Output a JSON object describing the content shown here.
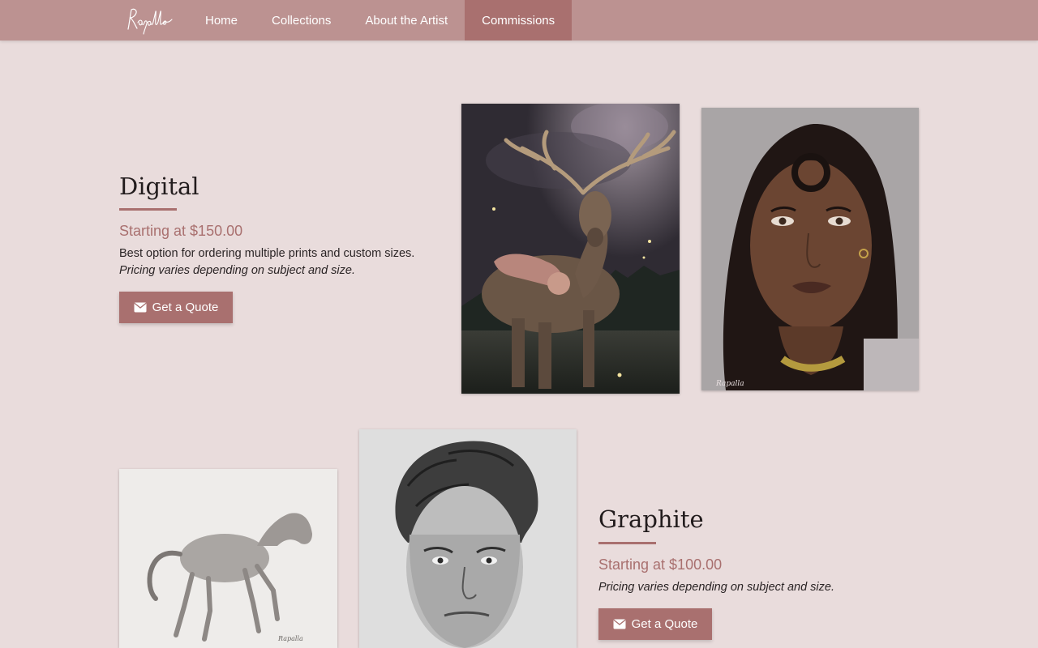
{
  "nav": {
    "logo_text": "Rapalla",
    "items": [
      {
        "label": "Home"
      },
      {
        "label": "Collections"
      },
      {
        "label": "About the Artist"
      },
      {
        "label": "Commissions"
      }
    ]
  },
  "digital": {
    "title": "Digital",
    "price": "Starting at $150.00",
    "description": "Best option for ordering multiple prints and custom sizes.",
    "note": "Pricing varies depending on subject and size.",
    "button_label": "Get a Quote",
    "button_icon": "envelope-icon",
    "artworks": [
      {
        "subject": "deer-with-fairy-painting"
      },
      {
        "subject": "woman-portrait-painting",
        "signature": "Rapalla"
      }
    ]
  },
  "graphite": {
    "title": "Graphite",
    "price": "Starting at $100.00",
    "note": "Pricing varies depending on subject and size.",
    "button_label": "Get a Quote",
    "button_icon": "envelope-icon",
    "artworks": [
      {
        "subject": "horse-graphite-drawing",
        "signature": "Rapalla"
      },
      {
        "subject": "man-portrait-graphite-drawing"
      }
    ]
  },
  "colors": {
    "nav_bg": "#bc9291",
    "nav_active": "#a9706f",
    "page_bg": "#e9dcdc",
    "accent": "#a9706f"
  }
}
